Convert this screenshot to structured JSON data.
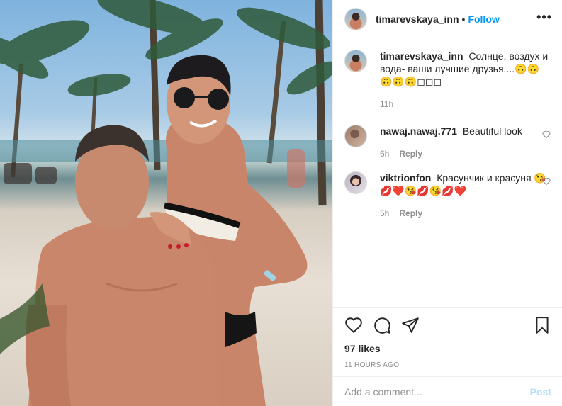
{
  "header": {
    "username": "timarevskaya_inn",
    "separator": "•",
    "follow_label": "Follow",
    "more_label": "•••"
  },
  "caption": {
    "username": "timarevskaya_inn",
    "text": "Солнце, воздух и вода- ваши лучшие друзья....🙃🙃🙃🙃🙃◻◻◻",
    "time": "11h"
  },
  "comments": [
    {
      "username": "nawaj.nawaj.771",
      "text": "Beautiful look",
      "time": "6h",
      "reply_label": "Reply"
    },
    {
      "username": "viktrionfon",
      "text": "Красунчик и красуня 😘💋❤️😘💋😘💋❤️",
      "time": "5h",
      "reply_label": "Reply"
    }
  ],
  "actions": {
    "likes": "97 likes",
    "timestamp": "11 HOURS AGO"
  },
  "add_comment": {
    "placeholder": "Add a comment...",
    "post_label": "Post"
  },
  "colors": {
    "accent": "#0095f6",
    "post_disabled": "#b2dffc",
    "muted": "#8e8e8e"
  },
  "icons": [
    "heart-icon",
    "comment-icon",
    "share-icon",
    "bookmark-icon",
    "more-icon"
  ]
}
